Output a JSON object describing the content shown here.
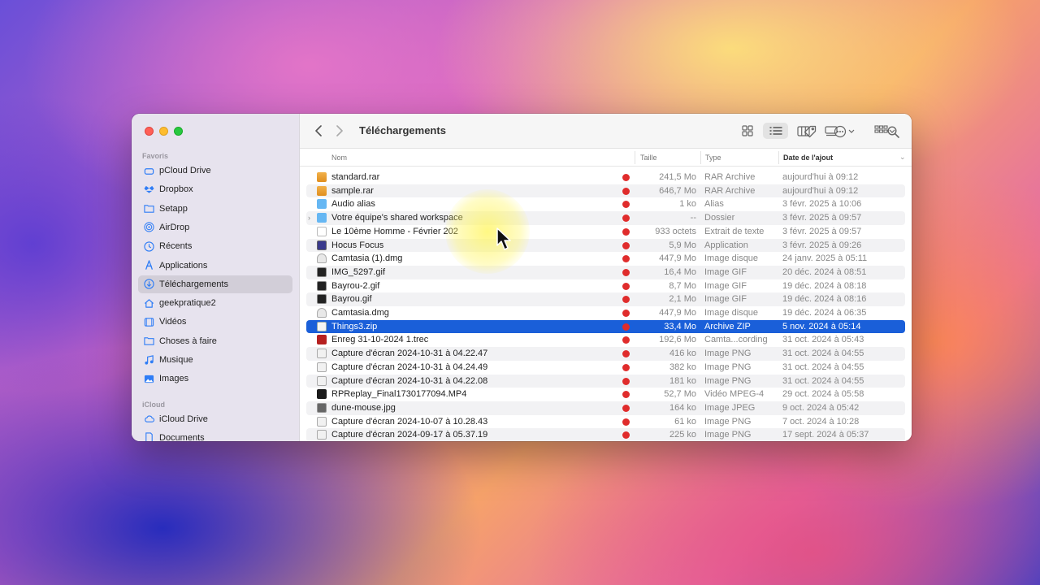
{
  "window": {
    "title": "Téléchargements"
  },
  "sidebar": {
    "sections": [
      {
        "label": "Favoris",
        "items": [
          {
            "label": "pCloud Drive",
            "icon": "drive-icon",
            "active": false
          },
          {
            "label": "Dropbox",
            "icon": "dropbox-icon",
            "active": false
          },
          {
            "label": "Setapp",
            "icon": "folder-icon",
            "active": false
          },
          {
            "label": "AirDrop",
            "icon": "airdrop-icon",
            "active": false
          },
          {
            "label": "Récents",
            "icon": "clock-icon",
            "active": false
          },
          {
            "label": "Applications",
            "icon": "applications-icon",
            "active": false
          },
          {
            "label": "Téléchargements",
            "icon": "download-icon",
            "active": true
          },
          {
            "label": "geekpratique2",
            "icon": "home-icon",
            "active": false
          },
          {
            "label": "Vidéos",
            "icon": "video-icon",
            "active": false
          },
          {
            "label": "Choses à faire",
            "icon": "folder-icon",
            "active": false
          },
          {
            "label": "Musique",
            "icon": "music-icon",
            "active": false
          },
          {
            "label": "Images",
            "icon": "photo-icon",
            "active": false
          }
        ]
      },
      {
        "label": "iCloud",
        "items": [
          {
            "label": "iCloud Drive",
            "icon": "cloud-icon",
            "active": false
          },
          {
            "label": "Documents",
            "icon": "document-icon",
            "active": false
          }
        ]
      }
    ]
  },
  "columns": {
    "name": "Nom",
    "size": "Taille",
    "type": "Type",
    "date": "Date de l'ajout"
  },
  "files": [
    {
      "name": "standard.rar",
      "size": "241,5 Mo",
      "type": "RAR Archive",
      "date": "aujourd'hui à 09:12",
      "icon": "archive",
      "tag": true
    },
    {
      "name": "sample.rar",
      "size": "646,7 Mo",
      "type": "RAR Archive",
      "date": "aujourd'hui à 09:12",
      "icon": "archive",
      "tag": true
    },
    {
      "name": "Audio alias",
      "size": "1 ko",
      "type": "Alias",
      "date": "3 févr. 2025 à 10:06",
      "icon": "folder",
      "tag": true
    },
    {
      "name": "Votre équipe's shared workspace",
      "size": "--",
      "type": "Dossier",
      "date": "3 févr. 2025 à 09:57",
      "icon": "folder",
      "tag": true,
      "expandable": true
    },
    {
      "name": "Le 10ème Homme - Février 202",
      "size": "933 octets",
      "type": "Extrait de texte",
      "date": "3 févr. 2025 à 09:57",
      "icon": "doc",
      "tag": true
    },
    {
      "name": "Hocus Focus",
      "size": "5,9 Mo",
      "type": "Application",
      "date": "3 févr. 2025 à 09:26",
      "icon": "app",
      "tag": true
    },
    {
      "name": "Camtasia (1).dmg",
      "size": "447,9 Mo",
      "type": "Image disque",
      "date": "24 janv. 2025 à 05:11",
      "icon": "dmg",
      "tag": true
    },
    {
      "name": "IMG_5297.gif",
      "size": "16,4 Mo",
      "type": "Image GIF",
      "date": "20 déc. 2024 à 08:51",
      "icon": "gif",
      "tag": true
    },
    {
      "name": "Bayrou-2.gif",
      "size": "8,7 Mo",
      "type": "Image GIF",
      "date": "19 déc. 2024 à 08:18",
      "icon": "gif",
      "tag": true
    },
    {
      "name": "Bayrou.gif",
      "size": "2,1 Mo",
      "type": "Image GIF",
      "date": "19 déc. 2024 à 08:16",
      "icon": "gif",
      "tag": true
    },
    {
      "name": "Camtasia.dmg",
      "size": "447,9 Mo",
      "type": "Image disque",
      "date": "19 déc. 2024 à 06:35",
      "icon": "dmg",
      "tag": true
    },
    {
      "name": "Things3.zip",
      "size": "33,4 Mo",
      "type": "Archive ZIP",
      "date": "5 nov. 2024 à 05:14",
      "icon": "zip",
      "tag": true,
      "selected": true
    },
    {
      "name": "Enreg 31-10-2024 1.trec",
      "size": "192,6 Mo",
      "type": "Camta...cording",
      "date": "31 oct. 2024 à 05:43",
      "icon": "trec",
      "tag": true
    },
    {
      "name": "Capture d'écran 2024-10-31 à 04.22.47",
      "size": "416 ko",
      "type": "Image PNG",
      "date": "31 oct. 2024 à 04:55",
      "icon": "png",
      "tag": true
    },
    {
      "name": "Capture d'écran 2024-10-31 à 04.24.49",
      "size": "382 ko",
      "type": "Image PNG",
      "date": "31 oct. 2024 à 04:55",
      "icon": "png",
      "tag": true
    },
    {
      "name": "Capture d'écran 2024-10-31 à 04.22.08",
      "size": "181 ko",
      "type": "Image PNG",
      "date": "31 oct. 2024 à 04:55",
      "icon": "png",
      "tag": true
    },
    {
      "name": "RPReplay_Final1730177094.MP4",
      "size": "52,7 Mo",
      "type": "Vidéo MPEG-4",
      "date": "29 oct. 2024 à 05:58",
      "icon": "mp4",
      "tag": true
    },
    {
      "name": "dune-mouse.jpg",
      "size": "164 ko",
      "type": "Image JPEG",
      "date": "9 oct. 2024 à 05:42",
      "icon": "jpg",
      "tag": true
    },
    {
      "name": "Capture d'écran 2024-10-07 à 10.28.43",
      "size": "61 ko",
      "type": "Image PNG",
      "date": "7 oct. 2024 à 10:28",
      "icon": "png",
      "tag": true
    },
    {
      "name": "Capture d'écran 2024-09-17 à 05.37.19",
      "size": "225 ko",
      "type": "Image PNG",
      "date": "17 sept. 2024 à 05:37",
      "icon": "png",
      "tag": true
    }
  ],
  "colors": {
    "selection": "#1a5fd9",
    "tag_red": "#e02c2c",
    "sidebar_accent": "#2f7df6"
  }
}
